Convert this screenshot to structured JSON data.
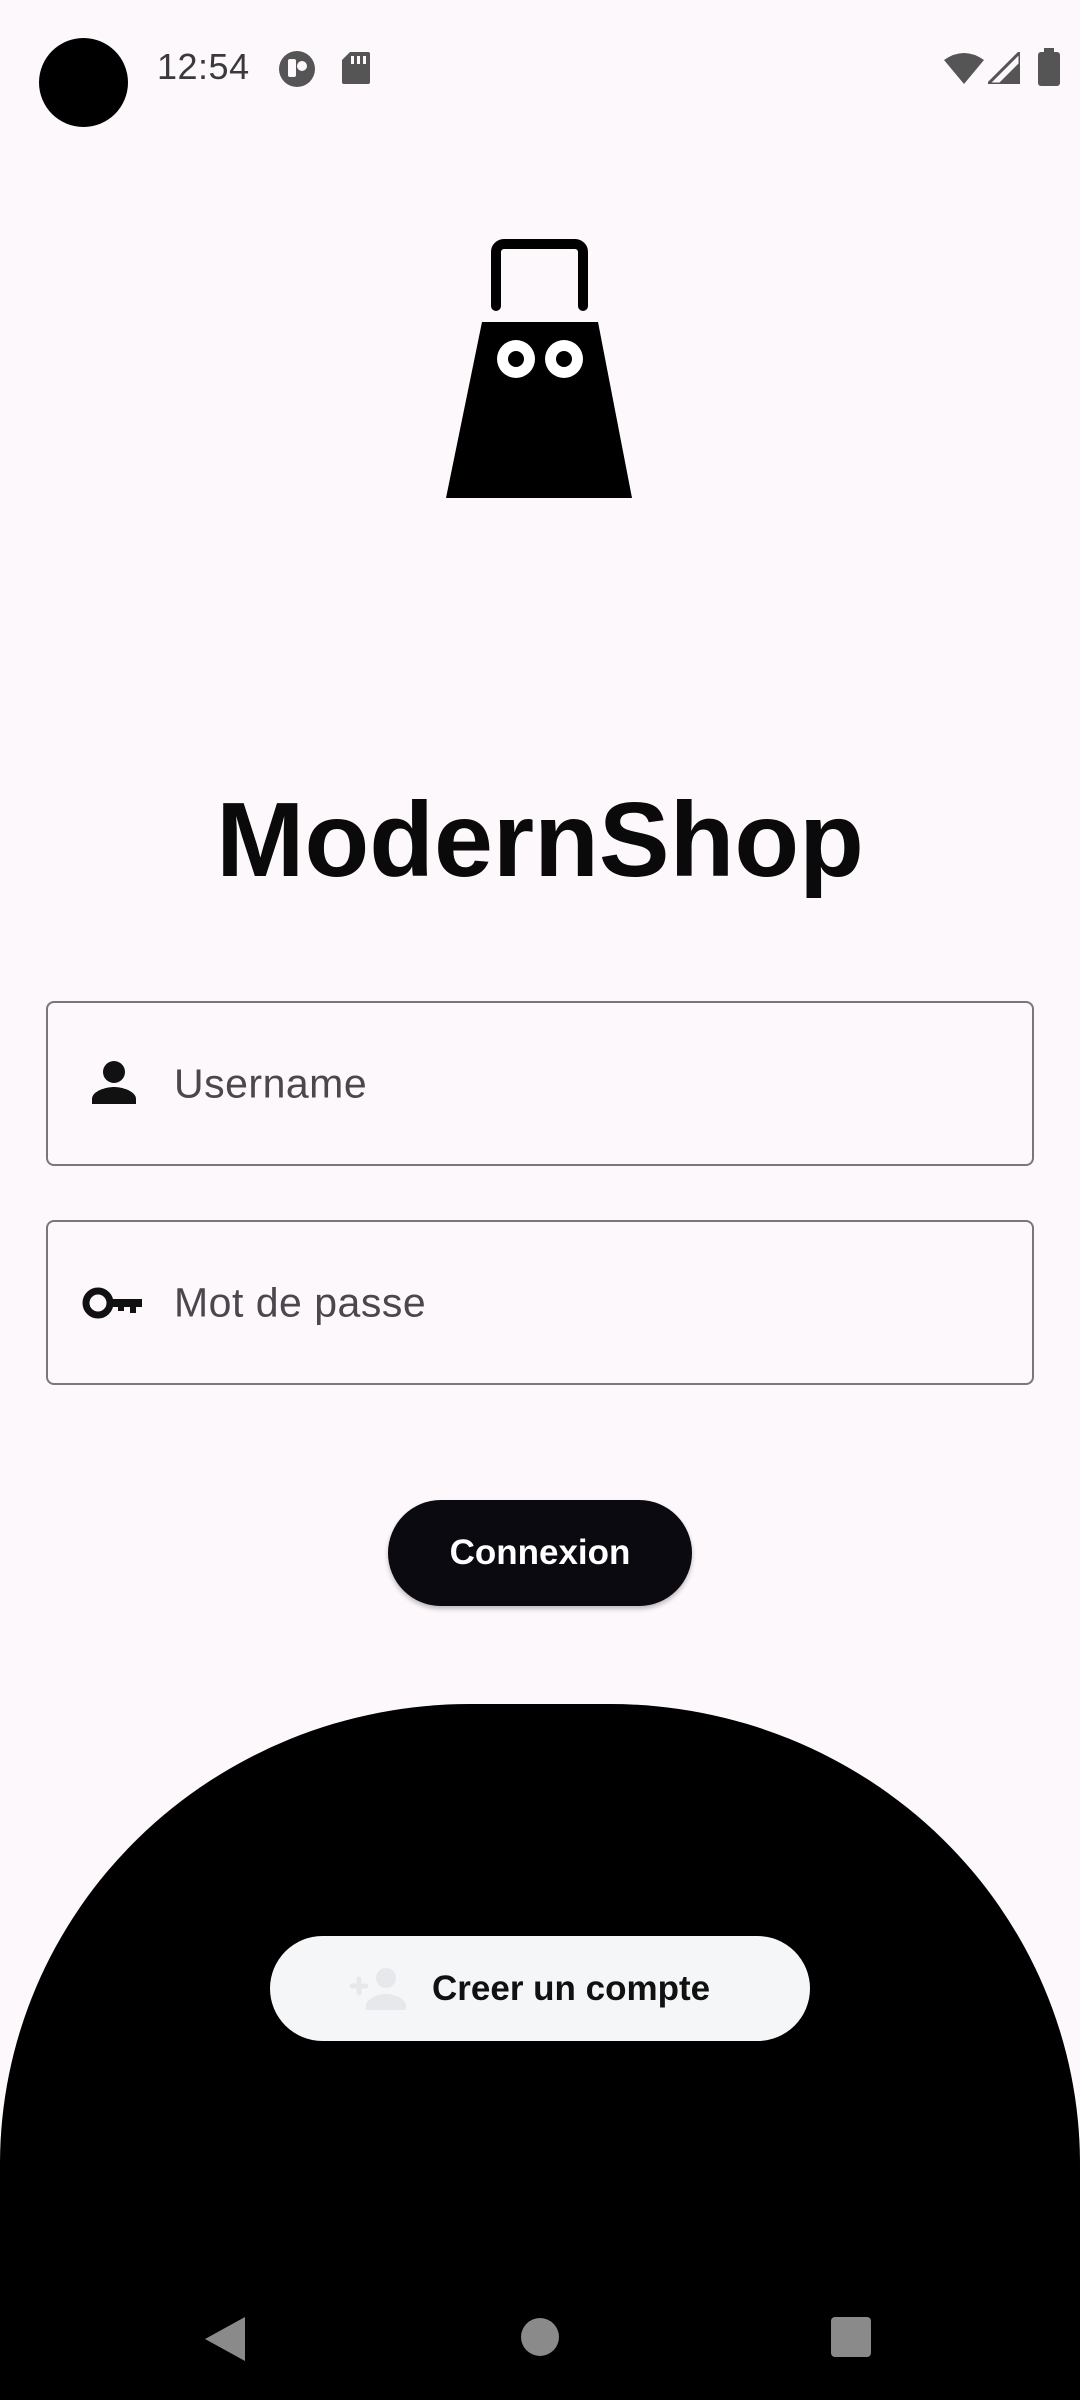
{
  "status_bar": {
    "time": "12:54"
  },
  "app": {
    "title": "ModernShop"
  },
  "form": {
    "username_placeholder": "Username",
    "password_placeholder": "Mot de passe",
    "login_label": "Connexion"
  },
  "signup": {
    "label": "Creer un compte"
  },
  "icons": {
    "logo": "shopping-bag-logo",
    "username": "person-icon",
    "password": "key-icon",
    "signup": "person-add-icon"
  },
  "colors": {
    "background": "#fdf8fc",
    "primary": "#0b0a10",
    "panel": "#000000",
    "signup_button": "#f5f6f8"
  }
}
